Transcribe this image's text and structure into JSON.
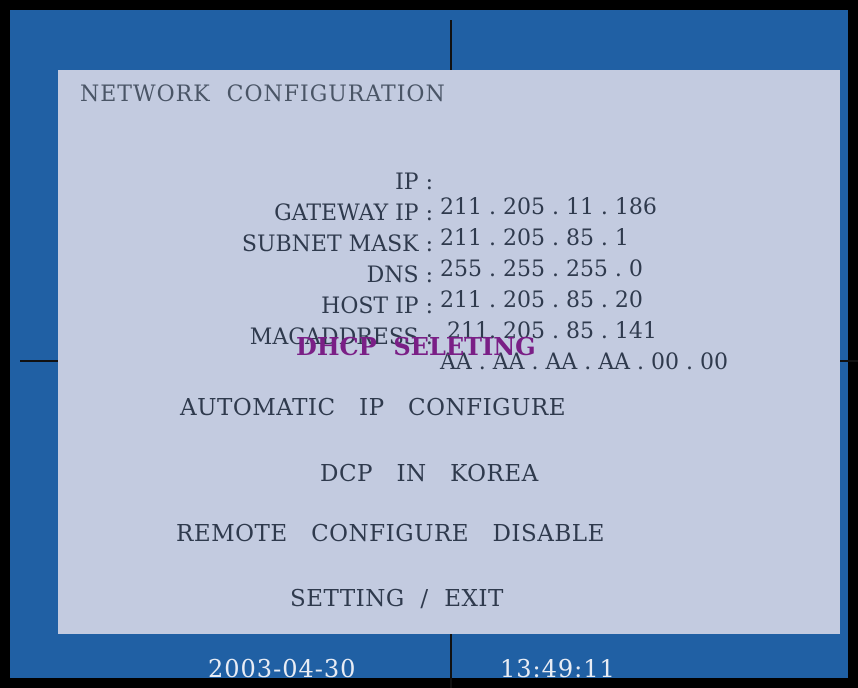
{
  "title": "NETWORK  CONFIGURATION",
  "network": {
    "ip": {
      "label": "IP :",
      "value": "211 . 205 . 11 . 186"
    },
    "gateway": {
      "label": "GATEWAY IP :",
      "value": "211 . 205 . 85 . 1"
    },
    "subnet": {
      "label": "SUBNET MASK :",
      "value": "255 . 255 . 255 . 0"
    },
    "dns": {
      "label": "DNS :",
      "value": "211 . 205 . 85 . 20"
    },
    "host": {
      "label": "HOST IP :",
      "value": " 211. 205 . 85 . 141"
    },
    "mac": {
      "label": "MACADDRESS :",
      "value": "AA . AA . AA . AA . 00 . 00"
    }
  },
  "dhcp_label": "DHCP  SELETING",
  "options": {
    "auto_ip": "AUTOMATIC   IP   CONFIGURE",
    "dcp": "DCP   IN   KOREA",
    "remote": "REMOTE   CONFIGURE   DISABLE",
    "setting_exit": "SETTING  /  EXIT"
  },
  "status": {
    "date": "2003-04-30",
    "time": "13:49:11"
  },
  "colors": {
    "background": "#2060a4",
    "panel": "#c3cbe0",
    "text": "#2f3a4d",
    "highlight": "#7a1f86"
  }
}
